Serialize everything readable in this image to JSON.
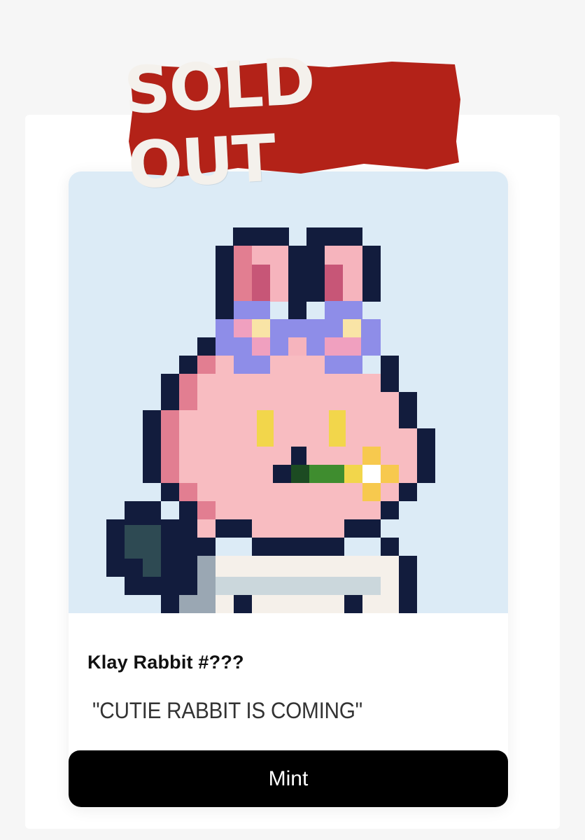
{
  "stamp": {
    "text": "SOLD OUT",
    "color": "#b32218"
  },
  "card": {
    "title": "Klay Rabbit #???",
    "subtitle": "\"CUTIE RABBIT IS COMING\"",
    "mint_label": "Mint",
    "art_background": "#dcebf6"
  }
}
